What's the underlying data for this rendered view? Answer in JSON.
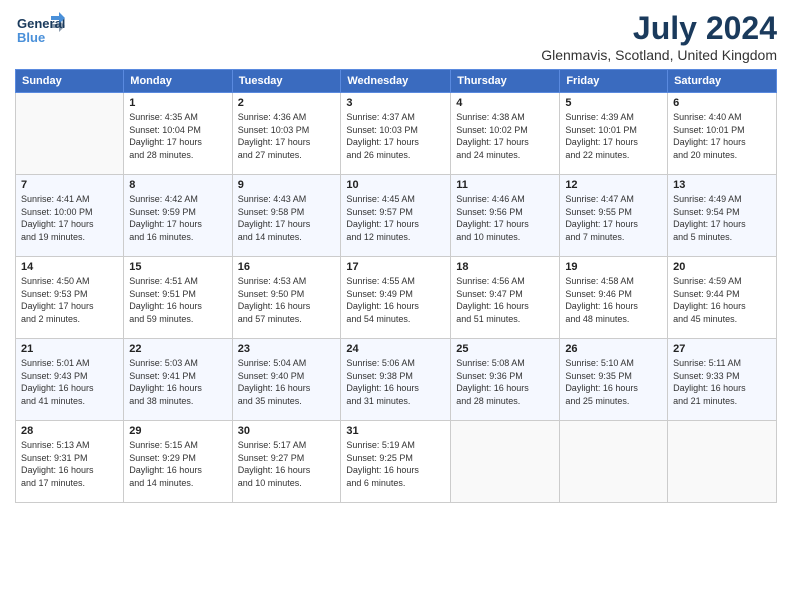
{
  "header": {
    "logo_line1": "General",
    "logo_line2": "Blue",
    "month": "July 2024",
    "location": "Glenmavis, Scotland, United Kingdom"
  },
  "days_of_week": [
    "Sunday",
    "Monday",
    "Tuesday",
    "Wednesday",
    "Thursday",
    "Friday",
    "Saturday"
  ],
  "weeks": [
    [
      {
        "day": "",
        "info": ""
      },
      {
        "day": "1",
        "info": "Sunrise: 4:35 AM\nSunset: 10:04 PM\nDaylight: 17 hours\nand 28 minutes."
      },
      {
        "day": "2",
        "info": "Sunrise: 4:36 AM\nSunset: 10:03 PM\nDaylight: 17 hours\nand 27 minutes."
      },
      {
        "day": "3",
        "info": "Sunrise: 4:37 AM\nSunset: 10:03 PM\nDaylight: 17 hours\nand 26 minutes."
      },
      {
        "day": "4",
        "info": "Sunrise: 4:38 AM\nSunset: 10:02 PM\nDaylight: 17 hours\nand 24 minutes."
      },
      {
        "day": "5",
        "info": "Sunrise: 4:39 AM\nSunset: 10:01 PM\nDaylight: 17 hours\nand 22 minutes."
      },
      {
        "day": "6",
        "info": "Sunrise: 4:40 AM\nSunset: 10:01 PM\nDaylight: 17 hours\nand 20 minutes."
      }
    ],
    [
      {
        "day": "7",
        "info": "Sunrise: 4:41 AM\nSunset: 10:00 PM\nDaylight: 17 hours\nand 19 minutes."
      },
      {
        "day": "8",
        "info": "Sunrise: 4:42 AM\nSunset: 9:59 PM\nDaylight: 17 hours\nand 16 minutes."
      },
      {
        "day": "9",
        "info": "Sunrise: 4:43 AM\nSunset: 9:58 PM\nDaylight: 17 hours\nand 14 minutes."
      },
      {
        "day": "10",
        "info": "Sunrise: 4:45 AM\nSunset: 9:57 PM\nDaylight: 17 hours\nand 12 minutes."
      },
      {
        "day": "11",
        "info": "Sunrise: 4:46 AM\nSunset: 9:56 PM\nDaylight: 17 hours\nand 10 minutes."
      },
      {
        "day": "12",
        "info": "Sunrise: 4:47 AM\nSunset: 9:55 PM\nDaylight: 17 hours\nand 7 minutes."
      },
      {
        "day": "13",
        "info": "Sunrise: 4:49 AM\nSunset: 9:54 PM\nDaylight: 17 hours\nand 5 minutes."
      }
    ],
    [
      {
        "day": "14",
        "info": "Sunrise: 4:50 AM\nSunset: 9:53 PM\nDaylight: 17 hours\nand 2 minutes."
      },
      {
        "day": "15",
        "info": "Sunrise: 4:51 AM\nSunset: 9:51 PM\nDaylight: 16 hours\nand 59 minutes."
      },
      {
        "day": "16",
        "info": "Sunrise: 4:53 AM\nSunset: 9:50 PM\nDaylight: 16 hours\nand 57 minutes."
      },
      {
        "day": "17",
        "info": "Sunrise: 4:55 AM\nSunset: 9:49 PM\nDaylight: 16 hours\nand 54 minutes."
      },
      {
        "day": "18",
        "info": "Sunrise: 4:56 AM\nSunset: 9:47 PM\nDaylight: 16 hours\nand 51 minutes."
      },
      {
        "day": "19",
        "info": "Sunrise: 4:58 AM\nSunset: 9:46 PM\nDaylight: 16 hours\nand 48 minutes."
      },
      {
        "day": "20",
        "info": "Sunrise: 4:59 AM\nSunset: 9:44 PM\nDaylight: 16 hours\nand 45 minutes."
      }
    ],
    [
      {
        "day": "21",
        "info": "Sunrise: 5:01 AM\nSunset: 9:43 PM\nDaylight: 16 hours\nand 41 minutes."
      },
      {
        "day": "22",
        "info": "Sunrise: 5:03 AM\nSunset: 9:41 PM\nDaylight: 16 hours\nand 38 minutes."
      },
      {
        "day": "23",
        "info": "Sunrise: 5:04 AM\nSunset: 9:40 PM\nDaylight: 16 hours\nand 35 minutes."
      },
      {
        "day": "24",
        "info": "Sunrise: 5:06 AM\nSunset: 9:38 PM\nDaylight: 16 hours\nand 31 minutes."
      },
      {
        "day": "25",
        "info": "Sunrise: 5:08 AM\nSunset: 9:36 PM\nDaylight: 16 hours\nand 28 minutes."
      },
      {
        "day": "26",
        "info": "Sunrise: 5:10 AM\nSunset: 9:35 PM\nDaylight: 16 hours\nand 25 minutes."
      },
      {
        "day": "27",
        "info": "Sunrise: 5:11 AM\nSunset: 9:33 PM\nDaylight: 16 hours\nand 21 minutes."
      }
    ],
    [
      {
        "day": "28",
        "info": "Sunrise: 5:13 AM\nSunset: 9:31 PM\nDaylight: 16 hours\nand 17 minutes."
      },
      {
        "day": "29",
        "info": "Sunrise: 5:15 AM\nSunset: 9:29 PM\nDaylight: 16 hours\nand 14 minutes."
      },
      {
        "day": "30",
        "info": "Sunrise: 5:17 AM\nSunset: 9:27 PM\nDaylight: 16 hours\nand 10 minutes."
      },
      {
        "day": "31",
        "info": "Sunrise: 5:19 AM\nSunset: 9:25 PM\nDaylight: 16 hours\nand 6 minutes."
      },
      {
        "day": "",
        "info": ""
      },
      {
        "day": "",
        "info": ""
      },
      {
        "day": "",
        "info": ""
      }
    ]
  ]
}
